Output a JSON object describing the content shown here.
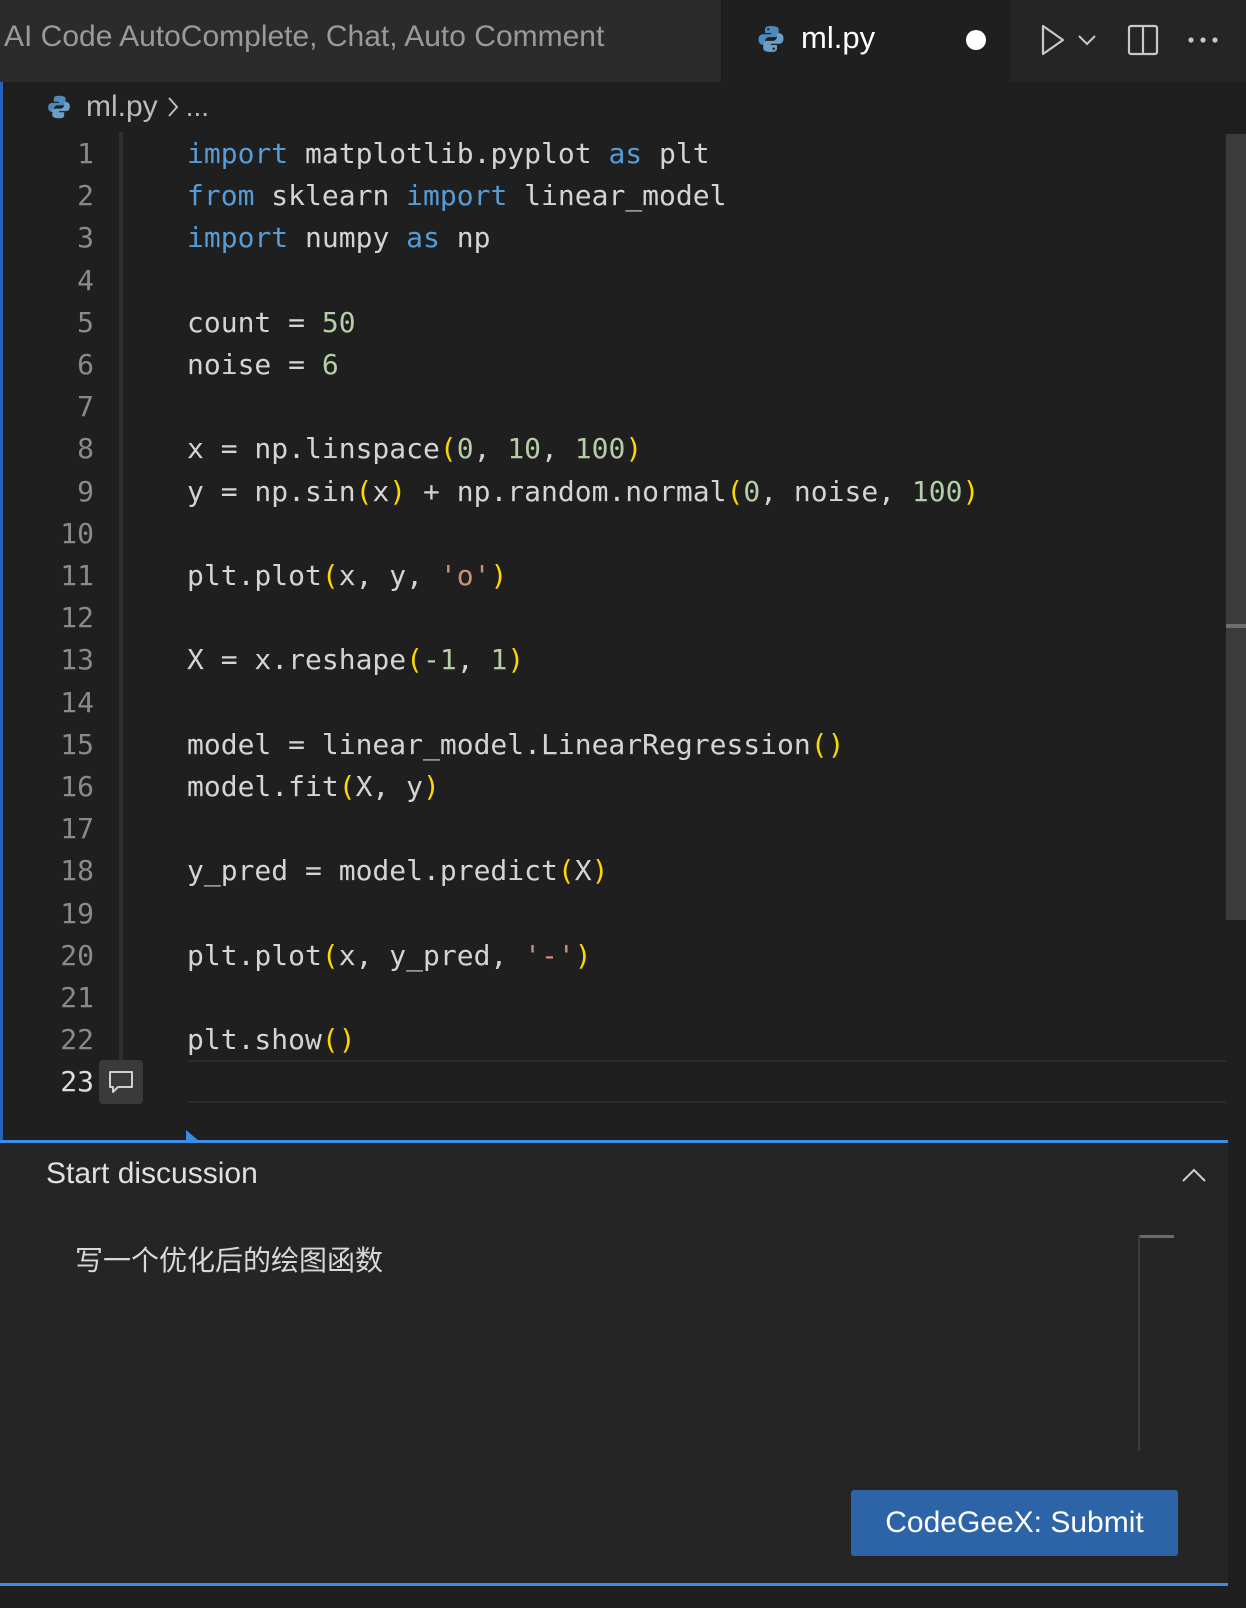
{
  "tabs": {
    "inactive_label": "AI Code AutoComplete, Chat, Auto Comment",
    "active_label": "ml.py",
    "active_icon": "python-icon",
    "active_dirty": true
  },
  "tab_actions": {
    "run_icon": "run-icon",
    "run_dropdown_icon": "chevron-down-icon",
    "split_icon": "split-editor-icon",
    "more_icon": "more-icon"
  },
  "breadcrumb": {
    "file": "ml.py",
    "ellipsis": "..."
  },
  "editor": {
    "active_line": 23,
    "lines": [
      {
        "n": "1"
      },
      {
        "n": "2"
      },
      {
        "n": "3"
      },
      {
        "n": "4"
      },
      {
        "n": "5"
      },
      {
        "n": "6"
      },
      {
        "n": "7"
      },
      {
        "n": "8"
      },
      {
        "n": "9"
      },
      {
        "n": "10"
      },
      {
        "n": "11"
      },
      {
        "n": "12"
      },
      {
        "n": "13"
      },
      {
        "n": "14"
      },
      {
        "n": "15"
      },
      {
        "n": "16"
      },
      {
        "n": "17"
      },
      {
        "n": "18"
      },
      {
        "n": "19"
      },
      {
        "n": "20"
      },
      {
        "n": "21"
      },
      {
        "n": "22"
      },
      {
        "n": "23"
      }
    ],
    "code": [
      [
        [
          "kw",
          "import"
        ],
        [
          "",
          "  matplotlib.pyplot "
        ],
        [
          "kw",
          "as"
        ],
        [
          "",
          " plt"
        ]
      ],
      [
        [
          "kw",
          "from"
        ],
        [
          "",
          " sklearn "
        ],
        [
          "kw",
          "import"
        ],
        [
          "",
          " linear_model"
        ]
      ],
      [
        [
          "kw",
          "import"
        ],
        [
          "",
          " numpy "
        ],
        [
          "kw",
          "as"
        ],
        [
          "",
          " np"
        ]
      ],
      [],
      [
        [
          "",
          "count = "
        ],
        [
          "num",
          "50"
        ]
      ],
      [
        [
          "",
          "noise = "
        ],
        [
          "num",
          "6"
        ]
      ],
      [],
      [
        [
          "",
          "x = np.linspace"
        ],
        [
          "br",
          "("
        ],
        [
          "num",
          "0"
        ],
        [
          "",
          ", "
        ],
        [
          "num",
          "10"
        ],
        [
          "",
          ", "
        ],
        [
          "num",
          "100"
        ],
        [
          "br",
          ")"
        ]
      ],
      [
        [
          "",
          "y = np.sin"
        ],
        [
          "br",
          "("
        ],
        [
          "",
          "x"
        ],
        [
          "br",
          ")"
        ],
        [
          "",
          " + np.random.normal"
        ],
        [
          "br",
          "("
        ],
        [
          "num",
          "0"
        ],
        [
          "",
          ", noise, "
        ],
        [
          "num",
          "100"
        ],
        [
          "br",
          ")"
        ]
      ],
      [],
      [
        [
          "",
          "plt.plot"
        ],
        [
          "br",
          "("
        ],
        [
          "",
          "x, y, "
        ],
        [
          "str",
          "'o'"
        ],
        [
          "br",
          ")"
        ]
      ],
      [],
      [
        [
          "",
          "X = x.reshape"
        ],
        [
          "br",
          "("
        ],
        [
          "num",
          "-1"
        ],
        [
          "",
          ", "
        ],
        [
          "num",
          "1"
        ],
        [
          "br",
          ")"
        ]
      ],
      [],
      [
        [
          "",
          "model = linear_model.LinearRegression"
        ],
        [
          "br",
          "()"
        ]
      ],
      [
        [
          "",
          "model.fit"
        ],
        [
          "br",
          "("
        ],
        [
          "",
          "X, y"
        ],
        [
          "br",
          ")"
        ]
      ],
      [],
      [
        [
          "",
          "y_pred = model.predict"
        ],
        [
          "br",
          "("
        ],
        [
          "",
          "X"
        ],
        [
          "br",
          ")"
        ]
      ],
      [],
      [
        [
          "",
          "plt.plot"
        ],
        [
          "br",
          "("
        ],
        [
          "",
          "x, y_pred, "
        ],
        [
          "str",
          "'-'"
        ],
        [
          "br",
          ")"
        ]
      ],
      [],
      [
        [
          "",
          "plt.show"
        ],
        [
          "br",
          "()"
        ]
      ],
      []
    ],
    "comment_icon": "comment-icon"
  },
  "discussion": {
    "title": "Start discussion",
    "collapse_icon": "chevron-up-icon",
    "input_value": "写一个优化后的绘图函数",
    "submit_label": "CodeGeeX: Submit"
  },
  "colors": {
    "keyword": "#569cd6",
    "number": "#b5cea8",
    "string": "#ce9178",
    "bracket": "#ffd700",
    "accent": "#3a8ee6",
    "button": "#2d64a8"
  }
}
